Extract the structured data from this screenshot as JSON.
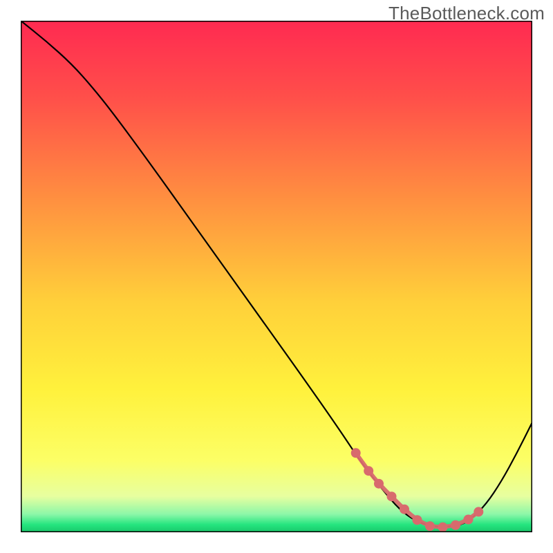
{
  "brand": {
    "watermark": "TheBottleneck.com"
  },
  "chart_data": {
    "type": "line",
    "title": "",
    "xlabel": "",
    "ylabel": "",
    "xlim": [
      0,
      100
    ],
    "ylim": [
      0,
      100
    ],
    "grid": false,
    "legend": false,
    "background_gradient_stops": [
      {
        "offset": 0.0,
        "color": "#ff2a51"
      },
      {
        "offset": 0.15,
        "color": "#ff4f4a"
      },
      {
        "offset": 0.35,
        "color": "#ff9040"
      },
      {
        "offset": 0.55,
        "color": "#ffd03a"
      },
      {
        "offset": 0.72,
        "color": "#fff13c"
      },
      {
        "offset": 0.86,
        "color": "#fcff66"
      },
      {
        "offset": 0.93,
        "color": "#e7ffa0"
      },
      {
        "offset": 0.965,
        "color": "#8bf7a8"
      },
      {
        "offset": 0.985,
        "color": "#25e57f"
      },
      {
        "offset": 1.0,
        "color": "#18c76a"
      }
    ],
    "series": [
      {
        "name": "bottleneck-curve",
        "color": "#000000",
        "stroke_width": 2.2,
        "x": [
          0.0,
          5.0,
          10.0,
          14.0,
          18.0,
          25.0,
          35.0,
          45.0,
          55.0,
          62.0,
          67.0,
          71.0,
          74.0,
          77.0,
          80.0,
          83.0,
          86.0,
          88.0,
          91.0,
          94.0,
          97.0,
          100.0
        ],
        "y": [
          100.0,
          96.0,
          91.5,
          87.0,
          82.0,
          72.5,
          58.5,
          44.5,
          30.5,
          20.5,
          13.0,
          8.0,
          4.5,
          2.3,
          1.2,
          1.0,
          1.4,
          2.5,
          5.5,
          10.0,
          15.5,
          21.5
        ]
      }
    ],
    "highlight": {
      "name": "valley-marker",
      "color": "#d86a6d",
      "dot_radius": 7,
      "line_width": 6,
      "x": [
        65.5,
        68.0,
        70.0,
        72.5,
        75.0,
        77.5,
        80.0,
        82.5,
        85.0,
        87.5,
        89.5
      ],
      "y": [
        15.5,
        12.0,
        9.5,
        7.0,
        4.5,
        2.4,
        1.2,
        1.0,
        1.4,
        2.5,
        4.0
      ]
    }
  }
}
